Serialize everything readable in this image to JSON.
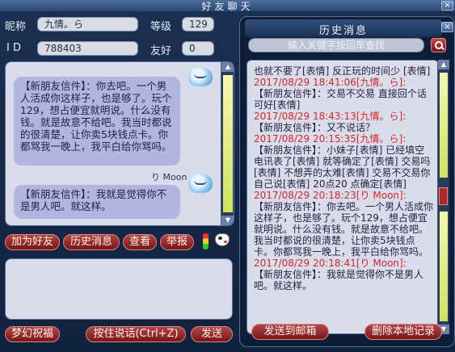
{
  "window": {
    "title": "好友聊天",
    "close_glyph": "×"
  },
  "profile": {
    "nickname_label": "昵称",
    "nickname_value": "九情。ら",
    "level_label": "等级",
    "level_value": "129",
    "id_label": "I D",
    "id_value": "788403",
    "friendship_label": "友好",
    "friendship_value": "0"
  },
  "chat": {
    "messages": [
      {
        "text": "【新朋友信件】：你去吧。一个男人活成你这样子，也是够了。玩个129，想占便宜就明说。什么没有钱。就是故意不给吧。我当时都说的很清楚，让你卖5块钱点卡。你都骂我一晚上，我平白给你骂吗。",
        "sender": "り Moon"
      },
      {
        "text": "【新朋友信件】：我就是觉得你不是男人吧。就这样。",
        "sender": ""
      }
    ]
  },
  "actions": {
    "add_friend": "加为好友",
    "history": "历史消息",
    "view": "查看",
    "report": "举报"
  },
  "bottom": {
    "blessing": "梦幻祝福",
    "voice": "按住说话(Ctrl+Z)",
    "send": "发送"
  },
  "history": {
    "title": "历史消息",
    "close_glyph": "×",
    "search_placeholder": "输入关键字按回车查找",
    "rows": [
      {
        "kind": "msg",
        "text": "也就不要了[表情] 反正玩的时间少 [表情]"
      },
      {
        "kind": "meta",
        "text": "2017/08/29 18:41:06[九情。ら]:"
      },
      {
        "kind": "msg",
        "text": "【新朋友信件】：交易不交易 直接回个话可好[表情]"
      },
      {
        "kind": "meta",
        "text": "2017/08/29 18:43:13[九情。ら]:"
      },
      {
        "kind": "msg",
        "text": "【新朋友信件】：又不说话？"
      },
      {
        "kind": "meta",
        "text": "2017/08/29 20:15:35[九情。ら]:"
      },
      {
        "kind": "msg",
        "text": "【新朋友信件】：小妹子[表情] 已经填空电讯表了[表情] 就等确定了[表情] 交易吗[表情] 不想弄的太难[表情] 交易不交易你自己说[表情] 20点20 点确定[表情]"
      },
      {
        "kind": "meta",
        "text": "2017/08/29 20:18:23[り Moon]:"
      },
      {
        "kind": "msg",
        "text": "【新朋友信件】：你去吧。一个男人活成你这样子，也是够了。玩个129，想占便宜就明说。什么没有钱。就是故意不给吧。我当时都说的很清楚，让你卖5块钱点卡。你都骂我一晚上，我平白给你骂吗。"
      },
      {
        "kind": "meta",
        "text": "2017/08/29 20:18:41[り Moon]:"
      },
      {
        "kind": "msg",
        "text": "【新朋友信件】：我就是觉得你不是男人吧。就这样。"
      }
    ],
    "send_to_mail": "发送到邮箱",
    "delete_local": "删除本地记录"
  },
  "icons": {
    "avatar": "cloud-avatar-icon",
    "traffic_light": "traffic-light-icon",
    "cow": "cow-icon",
    "search": "search-icon"
  },
  "colors": {
    "background": "#11223e",
    "button_red": "#8a1e1e",
    "timestamp_red": "#d52828",
    "bubble": "#b4b4e0"
  }
}
